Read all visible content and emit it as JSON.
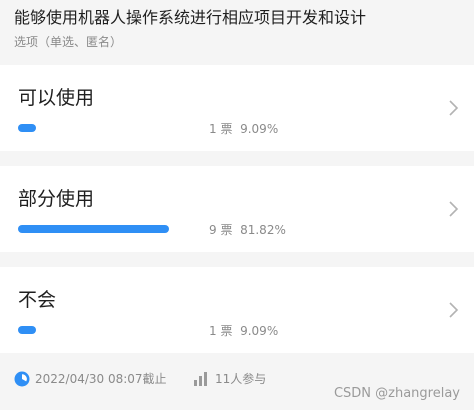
{
  "poll": {
    "title": "能够使用机器人操作系统进行相应项目开发和设计",
    "subtitle": "选项（单选、匿名）"
  },
  "options": [
    {
      "label": "可以使用",
      "votes_text": "1 票",
      "percent_text": "9.09%",
      "fraction": 0.0909
    },
    {
      "label": "部分使用",
      "votes_text": "9 票",
      "percent_text": "81.82%",
      "fraction": 0.8182
    },
    {
      "label": "不会",
      "votes_text": "1 票",
      "percent_text": "9.09%",
      "fraction": 0.0909
    }
  ],
  "footer": {
    "deadline": "2022/04/30 08:07截止",
    "participants": "11人参与"
  },
  "watermark": "CSDN @zhangrelay",
  "colors": {
    "accent": "#2f8ff5",
    "card": "#ffffff",
    "background": "#f5f5f5",
    "muted_text": "#8a8a8a"
  },
  "icons": {
    "chevron": "chevron-right-icon",
    "deadline": "clock-icon",
    "participants": "bar-stats-icon"
  }
}
